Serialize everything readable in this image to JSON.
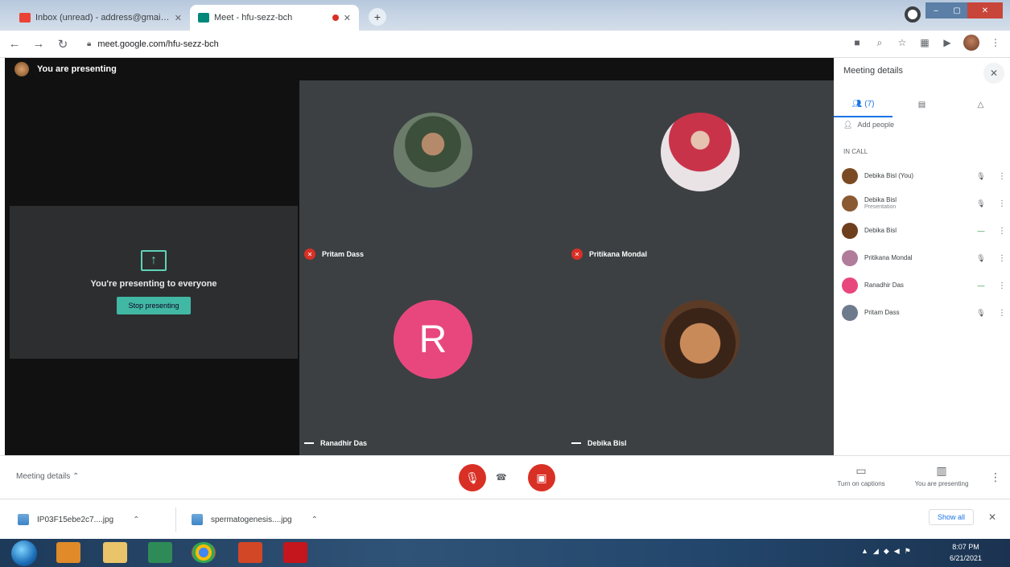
{
  "browser": {
    "tabs": [
      {
        "title": "Inbox (unread) - address@gmail.com",
        "active": false
      },
      {
        "title": "Meet - hfu-sezz-bch",
        "active": true
      }
    ],
    "url": "meet.google.com/hfu-sezz-bch"
  },
  "meet": {
    "presenting_banner": "You are presenting",
    "present_card": {
      "message": "You're presenting to everyone",
      "stop_button": "Stop presenting"
    },
    "participants_tiles": [
      {
        "name": "Pritam Dass",
        "muted": true
      },
      {
        "name": "Pritikana Mondal",
        "muted": true
      },
      {
        "name": "Ranadhir Das",
        "muted": false,
        "initial": "R"
      },
      {
        "name": "Debika Bisl",
        "muted": false
      }
    ],
    "side_panel": {
      "title": "Meeting details",
      "tabs": [
        "People",
        "Chat",
        "Activities"
      ],
      "people_tab_count": "(7)",
      "add_people": "Add people",
      "in_call_label": "IN CALL",
      "participants": [
        {
          "name": "Debika Bisl (You)",
          "sub": "",
          "mic": "muted",
          "avatar_color": "#7b4a22"
        },
        {
          "name": "Debika Bisl",
          "sub": "Presentation",
          "mic": "muted",
          "avatar_color": "#8a5a32"
        },
        {
          "name": "Debika Bisl",
          "sub": "",
          "mic": "active",
          "avatar_color": "#6d3f1d"
        },
        {
          "name": "Pritikana Mondal",
          "sub": "",
          "mic": "muted",
          "avatar_color": "#b07c9a"
        },
        {
          "name": "Ranadhir Das",
          "sub": "",
          "mic": "active",
          "avatar_color": "#e8477e"
        },
        {
          "name": "Pritam Dass",
          "sub": "",
          "mic": "muted",
          "avatar_color": "#6e7b8c"
        }
      ]
    },
    "bottom_bar": {
      "meeting_details": "Meeting details",
      "captions": "Turn on captions",
      "present": "You are presenting"
    }
  },
  "downloads": {
    "items": [
      "IP03F15ebe2c7....jpg",
      "spermatogenesis....jpg"
    ],
    "show_all": "Show all"
  },
  "taskbar": {
    "time": "8:07 PM",
    "date": "6/21/2021"
  }
}
